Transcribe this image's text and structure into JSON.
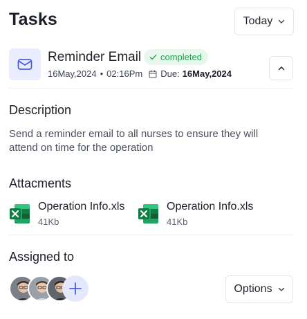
{
  "header": {
    "title": "Tasks",
    "filter_label": "Today"
  },
  "task": {
    "name": "Reminder Email",
    "icon": "mail-icon",
    "status": "completed",
    "date": "16May,2024",
    "time": "02:16Pm",
    "due_label": "Due:",
    "due_date": "16May,2024"
  },
  "description": {
    "heading": "Description",
    "text": "Send a reminder email to all nurses to ensure they will attend on time for the operation"
  },
  "attachments": {
    "heading": "Attacments",
    "items": [
      {
        "name": "Operation Info.xls",
        "size": "41Kb",
        "icon": "excel-file-icon"
      },
      {
        "name": "Operation Info.xls",
        "size": "41Kb",
        "icon": "excel-file-icon"
      }
    ]
  },
  "assigned": {
    "heading": "Assigned to",
    "options_label": "Options"
  },
  "colors": {
    "accent": "#4a5ce8",
    "status_green": "#20a14b",
    "excel_green": "#1f7a45"
  }
}
